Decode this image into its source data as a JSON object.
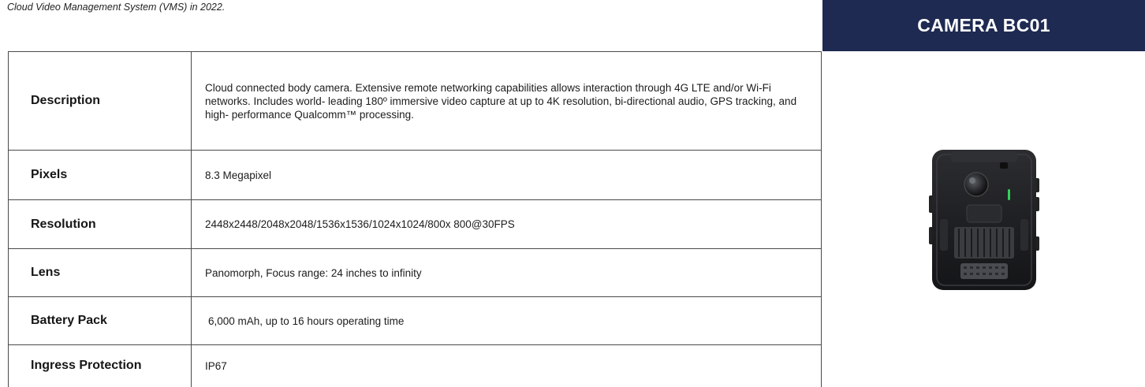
{
  "caption": "Cloud Video Management System (VMS) in 2022.",
  "panel": {
    "title": "CAMERA BC01",
    "header_color": "#1e2a52",
    "image": "body-camera-image"
  },
  "specs": {
    "rows": [
      {
        "label": "Description",
        "value": "Cloud connected body camera. Extensive remote networking capabilities allows interaction through 4G LTE and/or Wi-Fi networks. Includes world- leading 180º immersive video capture at up to 4K resolution, bi-directional audio, GPS tracking, and high- performance Qualcomm™ processing."
      },
      {
        "label": "Pixels",
        "value": "8.3 Megapixel"
      },
      {
        "label": "Resolution",
        "value": "2448x2448/2048x2048/1536x1536/1024x1024/800x 800@30FPS"
      },
      {
        "label": "Lens",
        "value": "Panomorph, Focus range: 24 inches to infinity"
      },
      {
        "label": "Battery Pack",
        "value": "6,000 mAh, up to 16 hours operating time"
      },
      {
        "label": "Ingress Protection",
        "value": "IP67"
      }
    ]
  }
}
